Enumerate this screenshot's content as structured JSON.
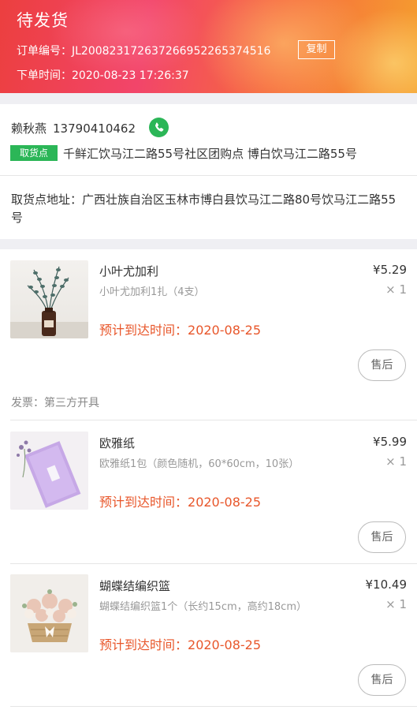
{
  "header": {
    "status": "待发货",
    "order_no_label": "订单编号：",
    "order_no": "JL200823172637266952265374516",
    "copy_label": "复制",
    "order_time_label": "下单时间：",
    "order_time": "2020-08-23 17:26:37"
  },
  "contact": {
    "name": "赖秋燕",
    "phone": "13790410462",
    "call_icon": "phone-icon",
    "pickup_tag": "取货点",
    "pickup_name": "千鲜汇饮马江二路55号社区团购点 博白饮马江二路55号"
  },
  "address": {
    "label": "取货点地址：",
    "value": "广西壮族自治区玉林市博白县饮马江二路80号饮马江二路55号"
  },
  "products": [
    {
      "name": "小叶尤加利",
      "spec": "小叶尤加利1扎（4支）",
      "price": "¥5.29",
      "qty": "× 1",
      "eta_label": "预计到达时间：",
      "eta": "2020-08-25",
      "after_sale": "售后"
    },
    {
      "name": "欧雅纸",
      "spec": "欧雅纸1包（颜色随机，60*60cm，10张）",
      "price": "¥5.99",
      "qty": "× 1",
      "eta_label": "预计到达时间：",
      "eta": "2020-08-25",
      "after_sale": "售后"
    },
    {
      "name": "蝴蝶结编织篮",
      "spec": "蝴蝶结编织篮1个（长约15cm，高约18cm）",
      "price": "¥10.49",
      "qty": "× 1",
      "eta_label": "预计到达时间：",
      "eta": "2020-08-25",
      "after_sale": "售后"
    }
  ],
  "invoice": "发票：第三方开具",
  "colors": {
    "accent_green": "#2bb657",
    "eta_orange": "#e8562a",
    "header_gradient_start": "#ec3f3f",
    "header_gradient_end": "#f59f2e"
  }
}
